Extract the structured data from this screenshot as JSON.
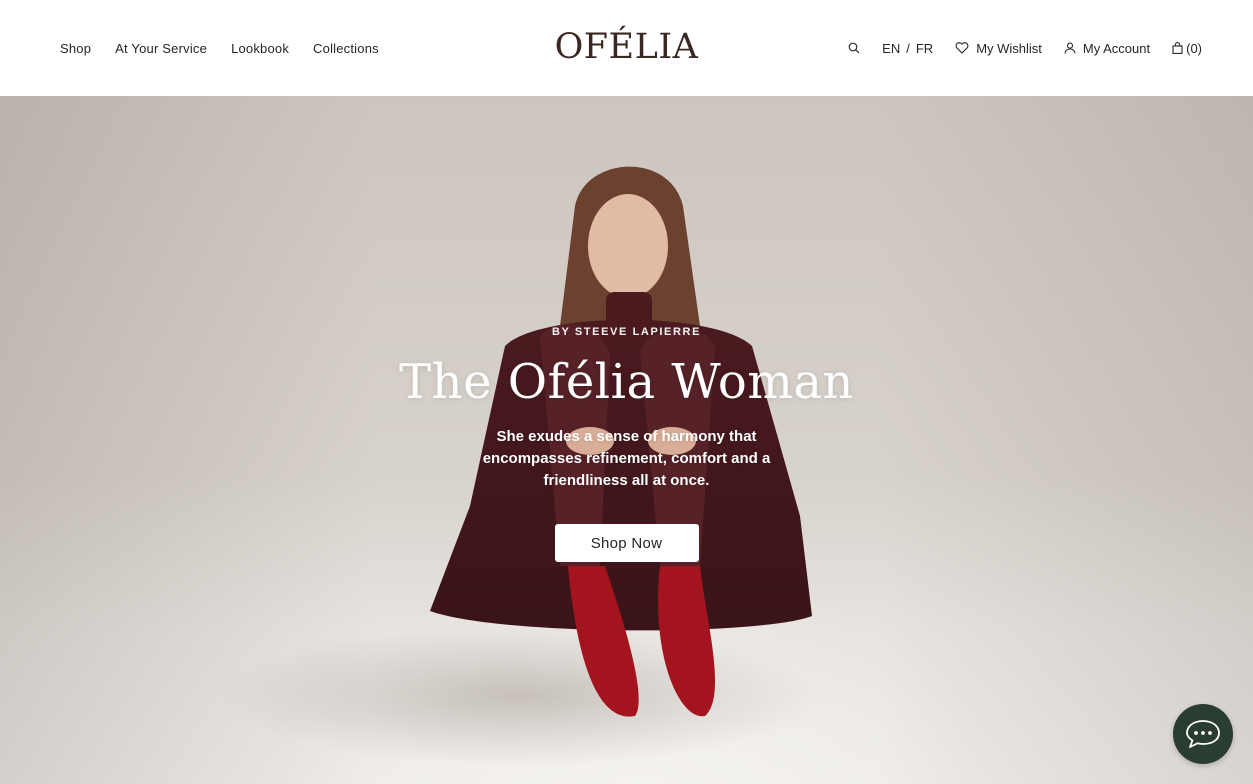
{
  "brand": {
    "logo_text": "OFÉLIA"
  },
  "nav": {
    "items": [
      {
        "label": "Shop"
      },
      {
        "label": "At Your Service"
      },
      {
        "label": "Lookbook"
      },
      {
        "label": "Collections"
      }
    ]
  },
  "utilities": {
    "search_icon": "search-icon",
    "lang_en": "EN",
    "lang_separator": "/",
    "lang_fr": "FR",
    "wishlist_label": "My Wishlist",
    "account_label": "My Account",
    "cart_count": "(0)"
  },
  "hero": {
    "kicker": "BY STEEVE LAPIERRE",
    "title": "The Ofélia Woman",
    "text": "She exudes a sense of harmony that encompasses refinement, comfort and a friendliness all at once.",
    "button_label": "Shop Now"
  },
  "chat": {
    "icon": "chat-bubble-icon"
  },
  "colors": {
    "logo": "#3a2622",
    "text": "#2b2522",
    "hero_text": "#ffffff",
    "sweater": "#4a1a1f",
    "shoes": "#a3141f",
    "chat_bg": "#2a3d33"
  }
}
